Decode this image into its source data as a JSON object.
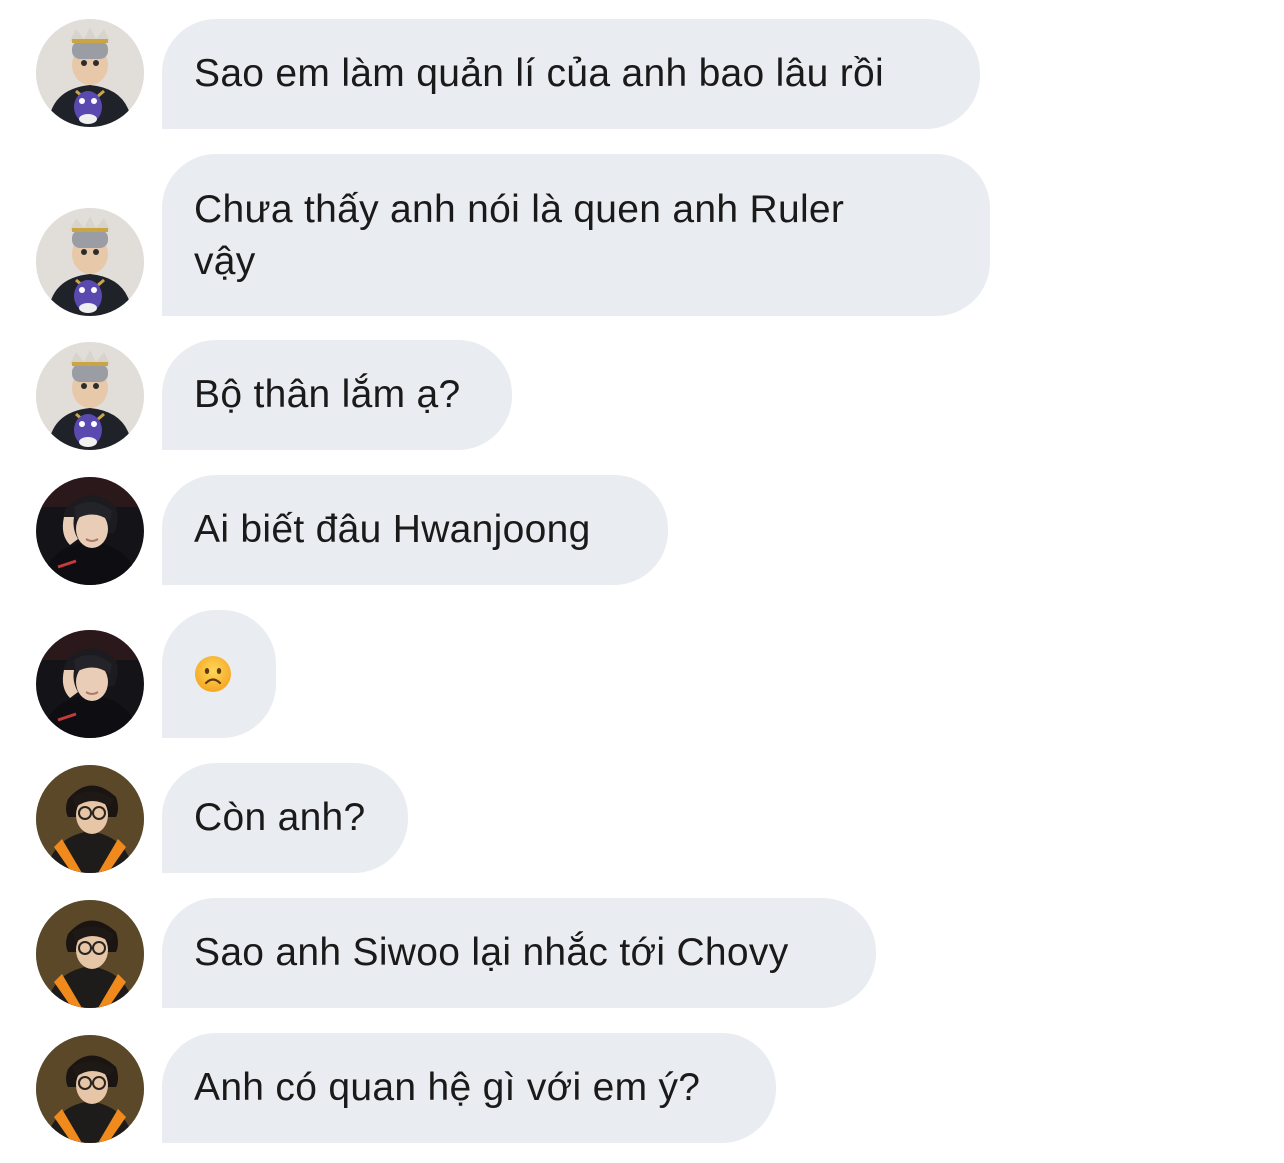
{
  "chat": {
    "messages": [
      {
        "sender": "gray-hat-user",
        "text": "Sao em làm quản lí của anh bao lâu rồi"
      },
      {
        "sender": "gray-hat-user",
        "text": "Chưa thấy anh nói là quen anh Ruler vậy"
      },
      {
        "sender": "gray-hat-user",
        "text": "Bộ thân lắm ạ?"
      },
      {
        "sender": "dark-jersey-user",
        "text": "Ai biết đâu Hwanjoong"
      },
      {
        "sender": "dark-jersey-user",
        "emoji": "frowning-face-emoji"
      },
      {
        "sender": "glasses-user",
        "text": "Còn anh?"
      },
      {
        "sender": "glasses-user",
        "text": "Sao anh Siwoo lại nhắc tới Chovy"
      },
      {
        "sender": "glasses-user",
        "text": "Anh có quan hệ gì với em ý?"
      }
    ]
  },
  "colors": {
    "bubble_background": "#e9ecf0",
    "text": "#1a1a1a",
    "page_background": "#ffffff"
  }
}
